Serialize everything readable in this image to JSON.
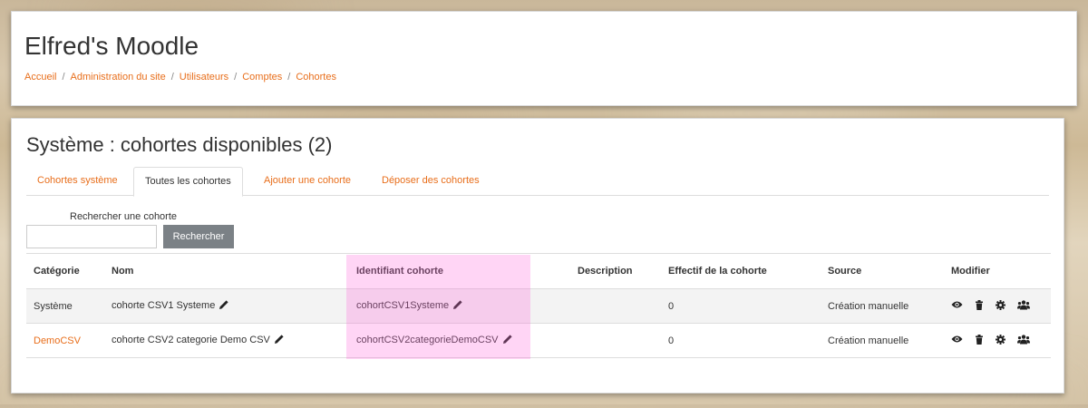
{
  "site": {
    "title": "Elfred's Moodle"
  },
  "breadcrumb": [
    "Accueil",
    "Administration du site",
    "Utilisateurs",
    "Comptes",
    "Cohortes"
  ],
  "page": {
    "title": "Système : cohortes disponibles (2)"
  },
  "tabs": [
    {
      "label": "Cohortes système",
      "active": false
    },
    {
      "label": "Toutes les cohortes",
      "active": true
    },
    {
      "label": "Ajouter une cohorte",
      "active": false
    },
    {
      "label": "Déposer des cohortes",
      "active": false
    }
  ],
  "search": {
    "label": "Rechercher une cohorte",
    "value": "",
    "button": "Rechercher"
  },
  "table": {
    "headers": [
      "Catégorie",
      "Nom",
      "Identifiant cohorte",
      "Description",
      "Effectif de la cohorte",
      "Source",
      "Modifier"
    ],
    "rows": [
      {
        "category": "Système",
        "category_link": false,
        "name": "cohorte CSV1 Systeme",
        "idnumber": "cohortCSV1Systeme",
        "description": "",
        "size": "0",
        "source": "Création manuelle"
      },
      {
        "category": "DemoCSV",
        "category_link": true,
        "name": "cohorte CSV2 categorie Demo CSV",
        "idnumber": "cohortCSV2categorieDemoCSV",
        "description": "",
        "size": "0",
        "source": "Création manuelle"
      }
    ]
  },
  "icons": [
    "eye-icon",
    "trash-icon",
    "gear-icon",
    "users-icon",
    "pencil-icon"
  ],
  "colors": {
    "link": "#e86e1b",
    "button": "#7b8186",
    "highlight": "#ff69dc"
  }
}
